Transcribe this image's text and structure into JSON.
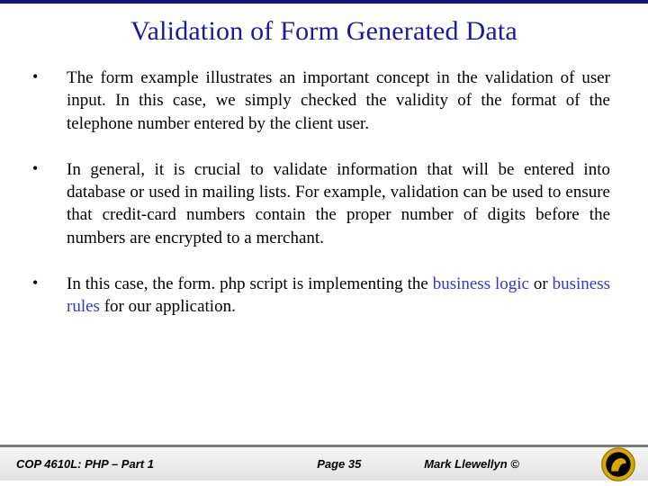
{
  "title": "Validation of Form Generated Data",
  "bullets": [
    {
      "text": "The form example illustrates an important concept in the validation of user input.  In this case, we simply checked the validity of the format of the telephone number entered by the client user."
    },
    {
      "text": "In general, it is crucial to validate information that will be entered into database or used in mailing lists.  For example, validation can be used to ensure that credit-card numbers contain the proper number of digits before the numbers are encrypted to a merchant."
    },
    {
      "prefix": "In this case, the form. php script is implementing the ",
      "hl1": "business logic",
      "mid": " or ",
      "hl2": "business rules",
      "suffix": " for our application."
    }
  ],
  "footer": {
    "course": "COP 4610L: PHP – Part 1",
    "page_label": "Page 35",
    "author": "Mark Llewellyn ©"
  },
  "icon": "pegasus-seal-icon"
}
